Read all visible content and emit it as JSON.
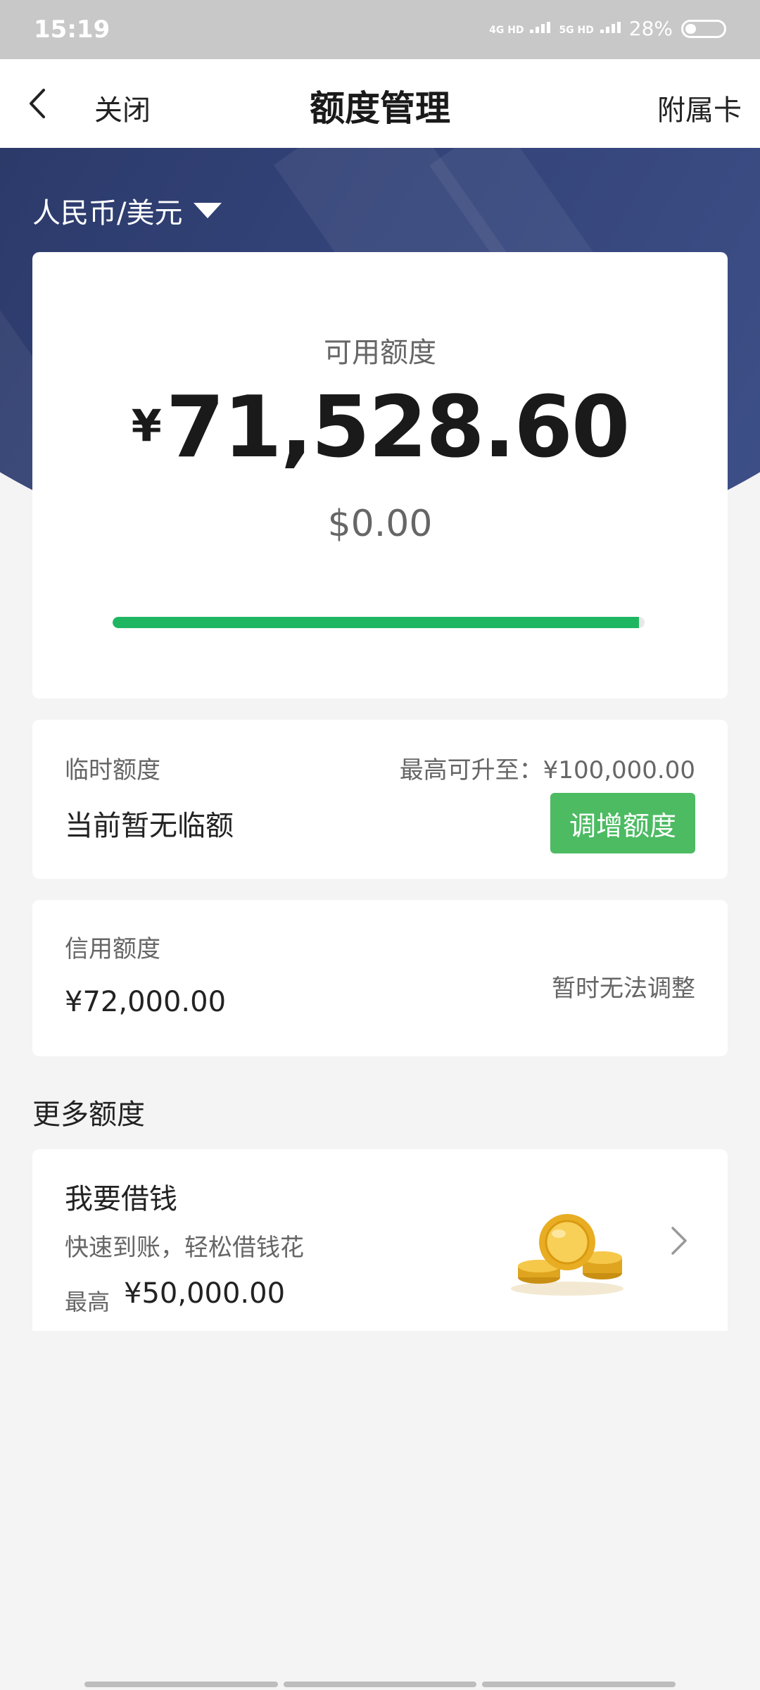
{
  "status_bar": {
    "time": "15:19",
    "network_1": "4G HD",
    "network_2": "5G HD",
    "battery": "28%",
    "battery_level": 0.28
  },
  "nav": {
    "back_icon": "chevron-left-icon",
    "close": "关闭",
    "title": "额度管理",
    "sub_card": "附属卡"
  },
  "currency": {
    "selected": "人民币/美元",
    "icon": "caret-down-icon"
  },
  "available": {
    "label": "可用额度",
    "symbol": "¥",
    "amount": "71,528.60",
    "usd": "$0.00",
    "progress": 0.99,
    "progress_color": "#1fb662"
  },
  "temporary": {
    "label": "临时额度",
    "max": "最高可升至：¥100,000.00",
    "status": "当前暂无临额",
    "button": "调增额度",
    "button_color": "#4cbb62"
  },
  "credit": {
    "label": "信用额度",
    "amount": "¥72,000.00",
    "note": "暂时无法调整"
  },
  "more": {
    "title": "更多额度"
  },
  "loan": {
    "title": "我要借钱",
    "desc": "快速到账，轻松借钱花",
    "max_label": "最高",
    "max_value": "¥50,000.00",
    "image_icon": "gold-coins-icon",
    "arrow_icon": "chevron-right-icon"
  },
  "colors": {
    "banner": "#34447a",
    "background": "#f4f4f4"
  }
}
